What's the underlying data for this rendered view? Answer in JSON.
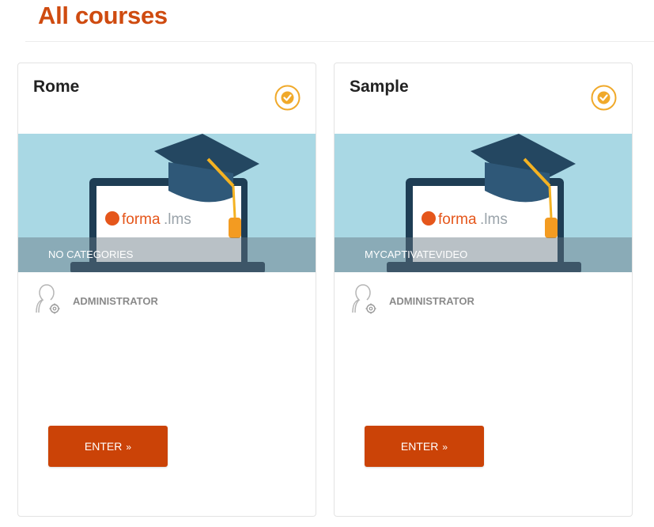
{
  "page": {
    "title": "All courses"
  },
  "colors": {
    "brand": "#cf4b10",
    "button": "#cb4307",
    "check": "#f0a92a",
    "banner_bg": "#a9d8e4"
  },
  "banner": {
    "logo_text_forma": "forma",
    "logo_text_lms": ".lms"
  },
  "courses": [
    {
      "name": "Rome",
      "category": "NO CATEGORIES",
      "teacher": "ADMINISTRATOR",
      "enter_label": "ENTER",
      "enter_icon": "double-chevron-right-icon",
      "status_icon": "check-circle-icon"
    },
    {
      "name": "Sample",
      "category": "MYCAPTIVATEVIDEO",
      "teacher": "ADMINISTRATOR",
      "enter_label": "ENTER",
      "enter_icon": "double-chevron-right-icon",
      "status_icon": "check-circle-icon"
    }
  ]
}
